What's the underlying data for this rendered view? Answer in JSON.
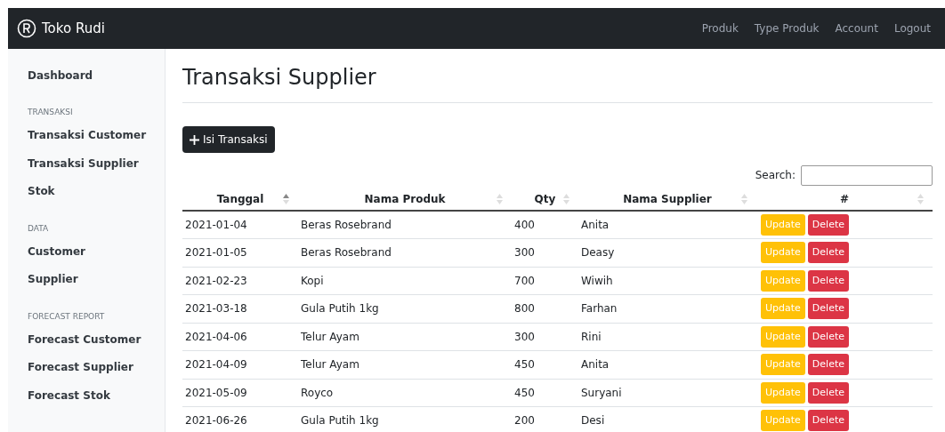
{
  "navbar": {
    "brand": "Toko Rudi",
    "links": [
      "Produk",
      "Type Produk",
      "Account",
      "Logout"
    ]
  },
  "sidebar": {
    "items": [
      {
        "kind": "link",
        "label": "Dashboard"
      },
      {
        "kind": "heading",
        "label": "TRANSAKSI"
      },
      {
        "kind": "link",
        "label": "Transaksi Customer"
      },
      {
        "kind": "link",
        "label": "Transaksi Supplier"
      },
      {
        "kind": "link",
        "label": "Stok"
      },
      {
        "kind": "heading",
        "label": "DATA"
      },
      {
        "kind": "link",
        "label": "Customer"
      },
      {
        "kind": "link",
        "label": "Supplier"
      },
      {
        "kind": "heading",
        "label": "FORECAST REPORT"
      },
      {
        "kind": "link",
        "label": "Forecast Customer"
      },
      {
        "kind": "link",
        "label": "Forecast Supplier"
      },
      {
        "kind": "link",
        "label": "Forecast Stok"
      }
    ]
  },
  "page_title": "Transaksi Supplier",
  "add_button": "Isi Transaksi",
  "search": {
    "label": "Search:"
  },
  "table": {
    "columns": [
      {
        "label": "Tanggal",
        "sorted_ascending": true
      },
      {
        "label": "Nama Produk",
        "sorted_ascending": false
      },
      {
        "label": "Qty",
        "sorted_ascending": false
      },
      {
        "label": "Nama Supplier",
        "sorted_ascending": false
      },
      {
        "label": "#",
        "sorted_ascending": false
      }
    ],
    "rows": [
      {
        "cells": [
          "2021-01-04",
          "Beras Rosebrand",
          "400",
          "Anita"
        ],
        "actions": [
          "Update",
          "Delete"
        ]
      },
      {
        "cells": [
          "2021-01-05",
          "Beras Rosebrand",
          "300",
          "Deasy"
        ],
        "actions": [
          "Update",
          "Delete"
        ]
      },
      {
        "cells": [
          "2021-02-23",
          "Kopi",
          "700",
          "Wiwih"
        ],
        "actions": [
          "Update",
          "Delete"
        ]
      },
      {
        "cells": [
          "2021-03-18",
          "Gula Putih 1kg",
          "800",
          "Farhan"
        ],
        "actions": [
          "Update",
          "Delete"
        ]
      },
      {
        "cells": [
          "2021-04-06",
          "Telur Ayam",
          "300",
          "Rini"
        ],
        "actions": [
          "Update",
          "Delete"
        ]
      },
      {
        "cells": [
          "2021-04-09",
          "Telur Ayam",
          "450",
          "Anita"
        ],
        "actions": [
          "Update",
          "Delete"
        ]
      },
      {
        "cells": [
          "2021-05-09",
          "Royco",
          "450",
          "Suryani"
        ],
        "actions": [
          "Update",
          "Delete"
        ]
      },
      {
        "cells": [
          "2021-06-26",
          "Gula Putih 1kg",
          "200",
          "Desi"
        ],
        "actions": [
          "Update",
          "Delete"
        ]
      }
    ]
  }
}
